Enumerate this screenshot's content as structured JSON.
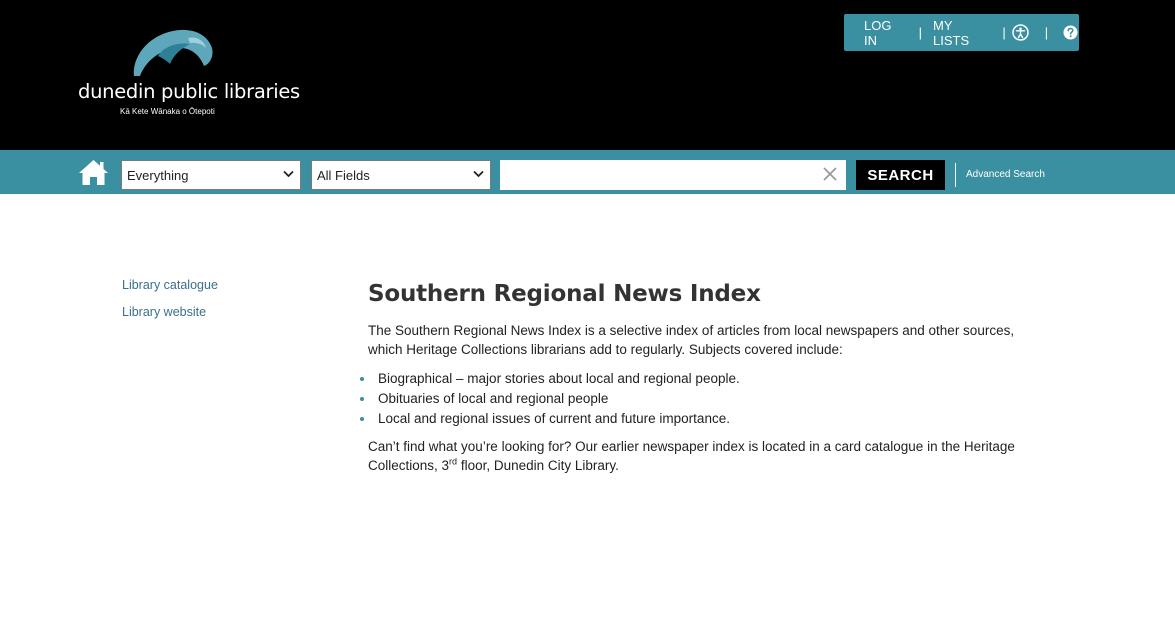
{
  "header": {
    "logo_name": "dunedin public libraries",
    "logo_subtitle": "Kā Kete Wānaka o Ōtepoti",
    "login_label": "LOG IN",
    "mylists_label": "MY LISTS",
    "accessibility_icon": "accessibility-icon",
    "help_icon": "help-icon",
    "separator": "|"
  },
  "search": {
    "scope_selected": "Everything",
    "field_selected": "All Fields",
    "query_value": "",
    "search_label": "SEARCH",
    "advanced_label": "Advanced Search"
  },
  "sidebar": {
    "items": [
      {
        "label": "Library catalogue"
      },
      {
        "label": "Library website"
      }
    ]
  },
  "main": {
    "title": "Southern Regional News Index",
    "intro": "The Southern Regional News Index is a selective index of articles from local newspapers and other sources, which Heritage Collections librarians add to regularly.  Subjects covered include:",
    "bullets": [
      "Biographical – major stories about local and regional people.",
      "Obituaries of local and regional people",
      "Local and regional issues of current and future importance."
    ],
    "outro_part1": "Can’t find what you’re looking for?  Our earlier newspaper index is located in a card catalogue in the Heritage Collections, 3",
    "outro_sup": "rd",
    "outro_part2": " floor, Dunedin City Library."
  },
  "colors": {
    "header_bg": "#000000",
    "accent_teal": "#3a8fa0",
    "link_blue": "#3a6f8e"
  }
}
